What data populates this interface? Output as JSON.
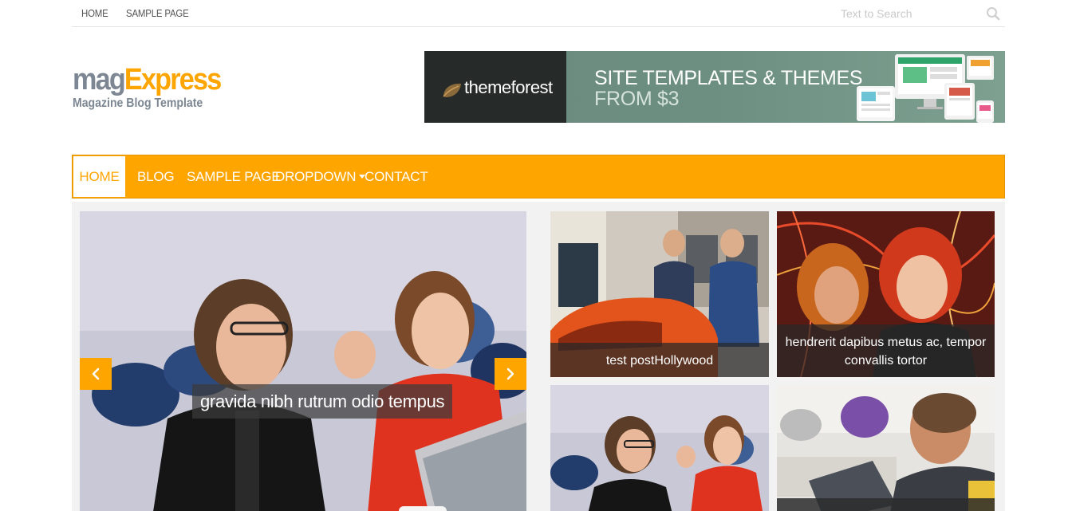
{
  "topnav": {
    "home": "HOME",
    "sample_page": "SAMPLE PAGE"
  },
  "search": {
    "placeholder": "Text to Search",
    "icon": "search-icon"
  },
  "logo": {
    "part1": "mag",
    "part2": "Express",
    "tagline": "Magazine Blog Template"
  },
  "banner": {
    "brand": "themeforest",
    "headline_line1": "SITE TEMPLATES & THEMES",
    "headline_line2": "FROM $3"
  },
  "menu": {
    "items": [
      {
        "label": "HOME",
        "active": true
      },
      {
        "label": "BLOG"
      },
      {
        "label": "SAMPLE PAGE"
      },
      {
        "label": "DROPDOWN",
        "has_dropdown": true
      },
      {
        "label": "CONTACT"
      }
    ]
  },
  "slider": {
    "caption": "gravida nibh rutrum odio tempus",
    "prev_icon": "chevron-left-icon",
    "next_icon": "chevron-right-icon"
  },
  "grid": [
    {
      "caption": "test postHollywood"
    },
    {
      "caption": "hendrerit dapibus metus ac, tempor convallis tortor"
    },
    {
      "caption": ""
    },
    {
      "caption": ""
    }
  ],
  "colors": {
    "accent": "#ffa500",
    "logo_gray": "#7d8793"
  }
}
